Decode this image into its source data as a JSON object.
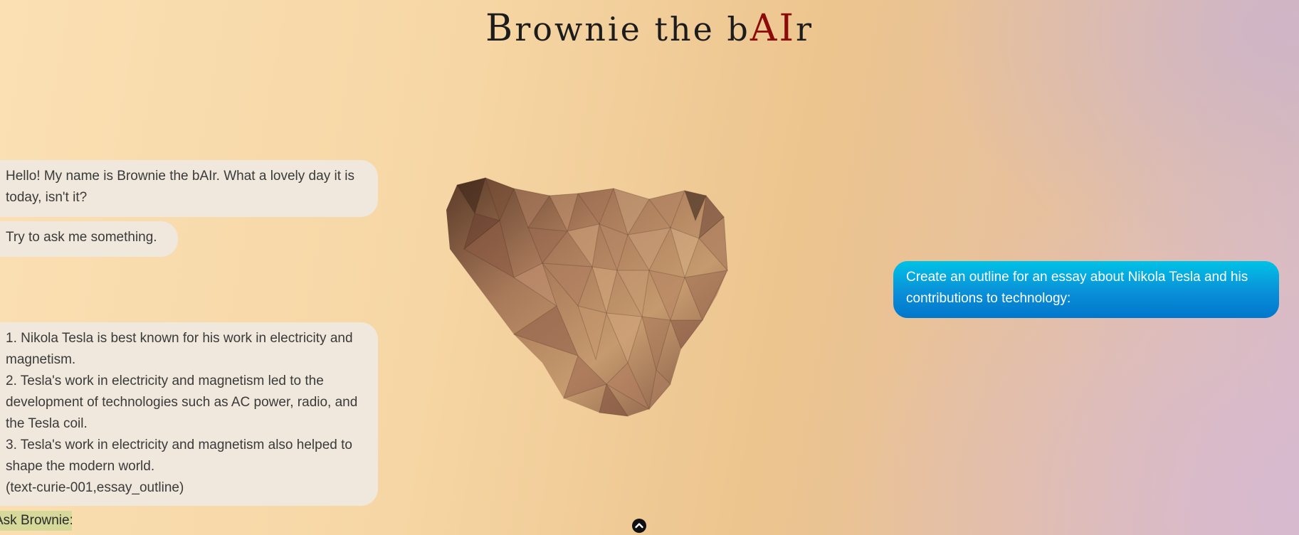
{
  "header": {
    "title_b": "B",
    "title_mid": "rownie the b",
    "title_ai": "AI",
    "title_end": "r"
  },
  "chat": {
    "bot_messages": [
      "Hello! My name is Brownie the bAIr. What a lovely day it is today, isn't it?",
      "Try to ask me something."
    ],
    "bot_reply_lines": [
      "1. Nikola Tesla is best known for his work in electricity and magnetism.",
      "2. Tesla's work in electricity and magnetism led to the development of technologies such as AC power, radio, and the Tesla coil.",
      "3. Tesla's work in electricity and magnetism also helped to shape the modern world.",
      "(text-curie-001,essay_outline)"
    ],
    "user_message": "Create an outline for an essay about Nikola Tesla and his contributions to technology:"
  },
  "input": {
    "ask_label": "Ask Brownie:"
  },
  "icons": {
    "bear": "low-poly-bear-head",
    "scroll": "chevron-up-circle-icon"
  },
  "colors": {
    "accent_ai": "#8b0a0a",
    "user_bubble": "#0a8fd8",
    "bot_bubble": "#f0e8dd",
    "ask_highlight": "#d6d99a"
  }
}
